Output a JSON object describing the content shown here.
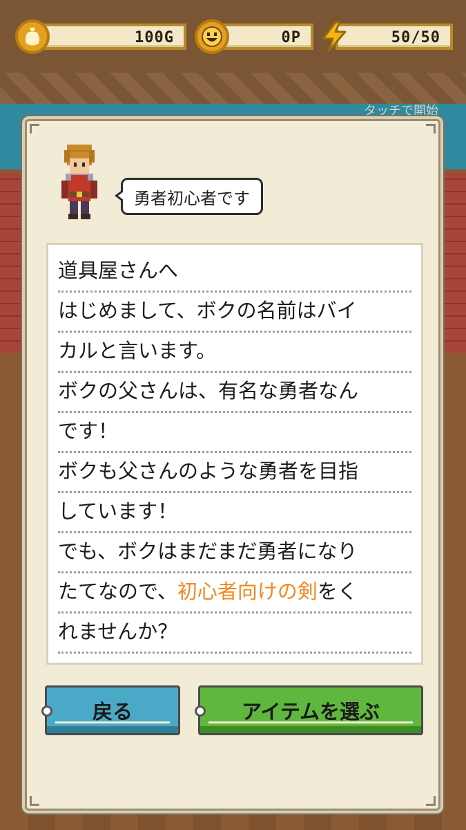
{
  "hud": {
    "gold": "100G",
    "points": "0P",
    "energy": "50/50"
  },
  "background_hint": "タッチで開始",
  "dialog": {
    "speaker_title": "勇者初心者です",
    "message_lines": [
      "道具屋さんへ",
      "はじめまして、ボクの名前はバイ",
      "カルと言います。",
      "ボクの父さんは、有名な勇者なん",
      "です！",
      "ボクも父さんのような勇者を目指",
      "しています！",
      "でも、ボクはまだまだ勇者になり"
    ],
    "line9_before": "たてなので、",
    "line9_highlight": "初心者向けの剣",
    "line9_after": "をく",
    "line10": "れませんか？"
  },
  "buttons": {
    "back_label": "戻る",
    "select_label": "アイテムを選ぶ"
  },
  "colors": {
    "highlight": "#f08a1e",
    "back_button": "#4aa9c6",
    "select_button": "#5fb83d",
    "gold_coin": "#e2a21f"
  },
  "icons": {
    "gold": "gold-coin-icon",
    "points": "smile-coin-icon",
    "energy": "lightning-bolt-icon"
  }
}
